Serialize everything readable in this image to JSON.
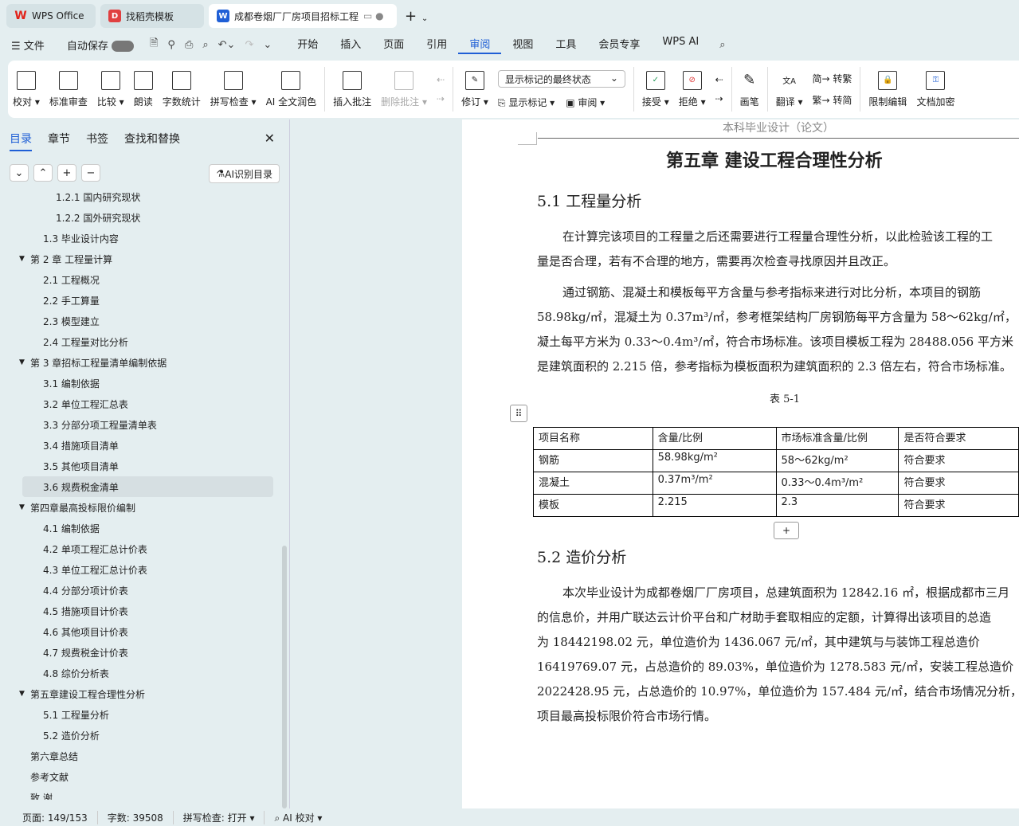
{
  "tabs": [
    {
      "label": "WPS Office",
      "icon": "W",
      "color": "#e2231a"
    },
    {
      "label": "找稻壳模板",
      "icon": "D",
      "color": "#e04040"
    },
    {
      "label": "成都卷烟厂厂房项目招标工程",
      "icon": "W",
      "color": "#1f5fd6"
    }
  ],
  "menu": {
    "file": "文件",
    "autosave": "自动保存",
    "items": [
      "开始",
      "插入",
      "页面",
      "引用",
      "审阅",
      "视图",
      "工具",
      "会员专享",
      "WPS AI"
    ],
    "active": "审阅"
  },
  "ribbon": {
    "group1": [
      {
        "label": "校对 ▾",
        "icon": "proofread-icon"
      },
      {
        "label": "标准审查",
        "icon": "standard-review-icon"
      },
      {
        "label": "比较 ▾",
        "icon": "compare-icon"
      },
      {
        "label": "朗读",
        "icon": "read-aloud-icon"
      },
      {
        "label": "字数统计",
        "icon": "word-count-icon"
      },
      {
        "label": "拼写检查 ▾",
        "icon": "spell-check-icon"
      },
      {
        "label": "AI 全文润色",
        "icon": "ai-polish-icon"
      }
    ],
    "group2": [
      {
        "label": "插入批注",
        "icon": "insert-comment-icon"
      },
      {
        "label": "删除批注 ▾",
        "icon": "delete-comment-icon",
        "disabled": true
      }
    ],
    "revise": "修订 ▾",
    "markup_select": "显示标记的最终状态",
    "show_markup": "显示标记 ▾",
    "review": "审阅 ▾",
    "accept": "接受 ▾",
    "reject": "拒绝 ▾",
    "pen": "画笔",
    "translate": "翻译 ▾",
    "to_trad": "转繁",
    "to_simp": "转简",
    "restrict": "限制编辑",
    "encrypt": "文档加密"
  },
  "panel": {
    "tabs": [
      "目录",
      "章节",
      "书签",
      "查找和替换"
    ],
    "ai_button": "AI识别目录",
    "toc": [
      {
        "t": "1.2.1 国内研究现状",
        "l": 2
      },
      {
        "t": "1.2.2 国外研究现状",
        "l": 2
      },
      {
        "t": "1.3 毕业设计内容",
        "l": 1
      },
      {
        "t": "第 2 章  工程量计算",
        "l": 0,
        "open": true
      },
      {
        "t": "2.1  工程概况",
        "l": 1
      },
      {
        "t": "2.2  手工算量",
        "l": 1
      },
      {
        "t": "2.3 模型建立",
        "l": 1
      },
      {
        "t": "2.4 工程量对比分析",
        "l": 1
      },
      {
        "t": "第 3 章招标工程量清单编制依据",
        "l": 0,
        "open": true
      },
      {
        "t": "3.1 编制依据",
        "l": 1
      },
      {
        "t": "3.2 单位工程汇总表",
        "l": 1
      },
      {
        "t": "3.3 分部分项工程量清单表",
        "l": 1
      },
      {
        "t": "3.4 措施项目清单",
        "l": 1
      },
      {
        "t": "3.5 其他项目清单",
        "l": 1
      },
      {
        "t": "3.6 规费税金清单",
        "l": 1,
        "selected": true
      },
      {
        "t": "第四章最高投标限价编制",
        "l": 0,
        "open": true
      },
      {
        "t": "4.1 编制依据",
        "l": 1
      },
      {
        "t": "4.2 单项工程汇总计价表",
        "l": 1
      },
      {
        "t": "4.3 单位工程汇总计价表",
        "l": 1
      },
      {
        "t": "4.4 分部分项计价表",
        "l": 1
      },
      {
        "t": "4.5 措施项目计价表",
        "l": 1
      },
      {
        "t": "4.6 其他项目计价表",
        "l": 1
      },
      {
        "t": "4.7 规费税金计价表",
        "l": 1
      },
      {
        "t": "4.8 综价分析表",
        "l": 1
      },
      {
        "t": "第五章建设工程合理性分析",
        "l": 0,
        "open": true
      },
      {
        "t": "5.1 工程量分析",
        "l": 1
      },
      {
        "t": "5.2 造价分析",
        "l": 1
      },
      {
        "t": "第六章总结",
        "l": 0
      },
      {
        "t": "参考文献",
        "l": 0
      },
      {
        "t": "致    谢",
        "l": 0
      }
    ]
  },
  "doc": {
    "header": "本科毕业设计（论文）",
    "chapter": "第五章  建设工程合理性分析",
    "s1": "5.1 工程量分析",
    "p1": [
      "在计算完该项目的工程量之后还需要进行工程量合理性分析，以此检验该工程的工",
      "量是否合理，若有不合理的地方，需要再次检查寻找原因并且改正。"
    ],
    "p2": [
      "通过钢筋、混凝土和模板每平方含量与参考指标来进行对比分析，本项目的钢筋",
      "58.98kg/㎡，混凝土为 0.37m³/㎡，参考框架结构厂房钢筋每平方含量为 58～62kg/㎡，",
      "凝土每平方米为 0.33～0.4m³/㎡，符合市场标准。该项目模板工程为 28488.056 平方米",
      "是建筑面积的 2.215 倍，参考指标为模板面积为建筑面积的 2.3 倍左右，符合市场标准。"
    ],
    "table_caption": "表 5-1",
    "table": [
      [
        "项目名称",
        "含量/比例",
        "市场标准含量/比例",
        "是否符合要求"
      ],
      [
        "钢筋",
        "58.98kg/m²",
        "58～62kg/m²",
        "符合要求"
      ],
      [
        "混凝土",
        "0.37m³/m²",
        "0.33～0.4m³/m²",
        "符合要求"
      ],
      [
        "模板",
        "2.215",
        "2.3",
        "符合要求"
      ]
    ],
    "s2": "5.2 造价分析",
    "p3": [
      "本次毕业设计为成都卷烟厂厂房项目，总建筑面积为 12842.16 ㎡，根据成都市三月",
      "的信息价，并用广联达云计价平台和广材助手套取相应的定额，计算得出该项目的总造",
      "为 18442198.02 元，单位造价为 1436.067 元/㎡，其中建筑与与装饰工程总造价",
      "16419769.07 元，占总造价的 89.03%，单位造价为 1278.583 元/㎡，安装工程总造价",
      "2022428.95 元，占总造价的 10.97%，单位造价为 157.484 元/㎡，结合市场情况分析，",
      "项目最高投标限价符合市场行情。"
    ]
  },
  "status": {
    "page": "页面: 149/153",
    "words": "字数: 39508",
    "spell": "拼写检查: 打开 ▾",
    "ai": "AI 校对 ▾"
  }
}
